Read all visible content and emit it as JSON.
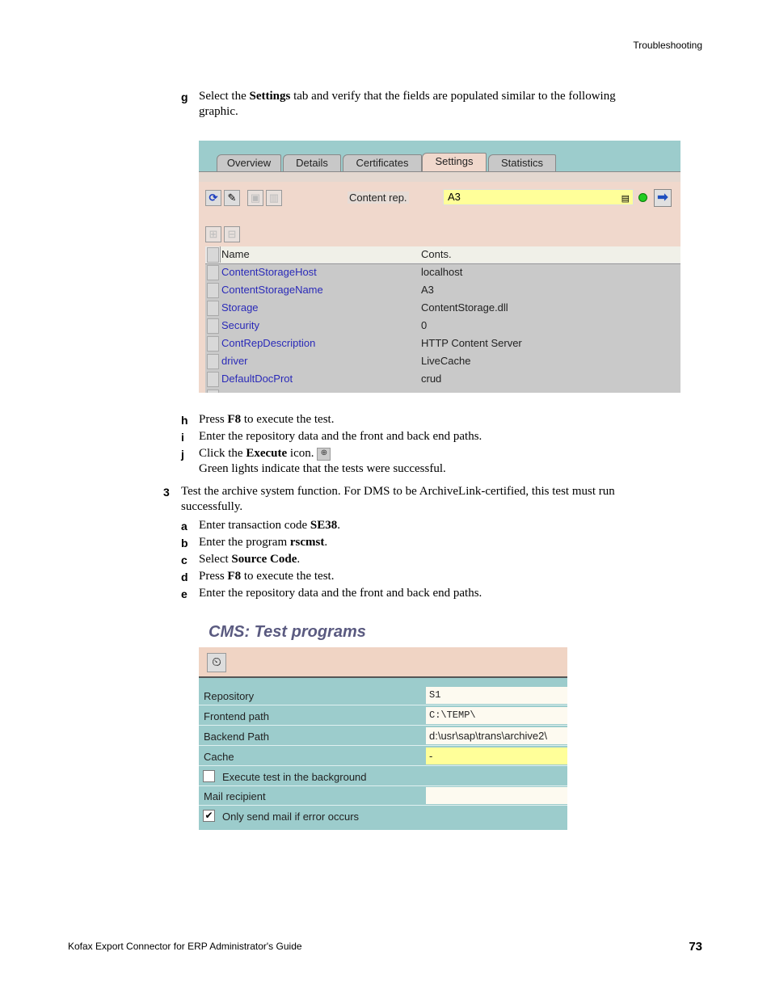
{
  "header": {
    "section": "Troubleshooting"
  },
  "steps": {
    "g": {
      "label": "g",
      "pre": "Select the ",
      "bold": "Settings",
      "post": " tab and verify that the fields are populated similar to the following",
      "line2": "graphic."
    },
    "h": {
      "label": "h",
      "pre": "Press ",
      "bold": "F8",
      "post": " to execute the test."
    },
    "i": {
      "label": "i",
      "text": "Enter the repository data and the front and back end paths."
    },
    "j": {
      "label": "j",
      "pre": "Click the ",
      "bold": "Execute",
      "post": " icon.",
      "line2": "Green lights indicate that the tests were successful."
    },
    "s3": {
      "label": "3",
      "line1": "Test the archive system function. For DMS to be ArchiveLink-certified, this test must run",
      "line2": "successfully."
    },
    "a": {
      "label": "a",
      "pre": "Enter transaction code ",
      "bold": "SE38",
      "post": "."
    },
    "b": {
      "label": "b",
      "pre": "Enter the program ",
      "bold": "rscmst",
      "post": "."
    },
    "c": {
      "label": "c",
      "pre": "Select ",
      "bold": "Source Code",
      "post": "."
    },
    "d": {
      "label": "d",
      "pre": "Press ",
      "bold": "F8",
      "post": " to execute the test."
    },
    "e": {
      "label": "e",
      "text": "Enter the repository data and the front and back end paths."
    }
  },
  "settings_screen": {
    "tabs": [
      "Overview",
      "Details",
      "Certificates",
      "Settings",
      "Statistics"
    ],
    "active_tab": "Settings",
    "content_rep_label": "Content rep.",
    "content_rep_value": "A3",
    "table": {
      "headers": [
        "Name",
        "Conts."
      ],
      "rows": [
        [
          "ContentStorageHost",
          "localhost"
        ],
        [
          "ContentStorageName",
          "A3"
        ],
        [
          "Storage",
          "ContentStorage.dll"
        ],
        [
          "Security",
          "0"
        ],
        [
          "ContRepDescription",
          "HTTP Content Server"
        ],
        [
          "driver",
          "LiveCache"
        ],
        [
          "DefaultDocProt",
          "crud"
        ]
      ]
    }
  },
  "test_programs_screen": {
    "title": "CMS: Test programs",
    "fields": [
      {
        "label": "Repository",
        "value": "S1"
      },
      {
        "label": "Frontend path",
        "value": "C:\\TEMP\\"
      },
      {
        "label": "Backend Path",
        "value": "d:\\usr\\sap\\trans\\archive2\\"
      },
      {
        "label": "Cache",
        "value": "-"
      }
    ],
    "execute_background": {
      "label": "Execute test in the background",
      "checked": false
    },
    "mail_recipient": {
      "label": "Mail recipient",
      "value": ""
    },
    "only_error_mail": {
      "label": "Only send mail if error occurs",
      "checked": true,
      "mark": "✔"
    }
  },
  "footer": {
    "title": "Kofax Export Connector for ERP Administrator's Guide",
    "page": "73"
  }
}
